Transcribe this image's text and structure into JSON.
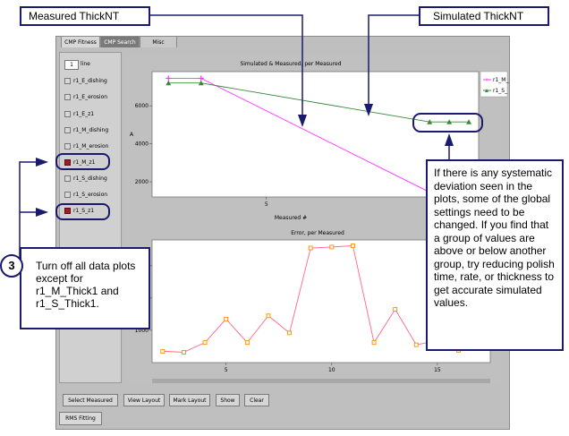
{
  "tabs": [
    "CMP Fitness",
    "CMP Search",
    "Misc"
  ],
  "spinner": {
    "value": "1",
    "label": "line"
  },
  "series_list": [
    {
      "label": "r1_E_dishing",
      "checked": false
    },
    {
      "label": "r1_E_erosion",
      "checked": false
    },
    {
      "label": "r1_E_z1",
      "checked": false
    },
    {
      "label": "r1_M_dishing",
      "checked": false
    },
    {
      "label": "r1_M_erosion",
      "checked": false
    },
    {
      "label": "r1_M_z1",
      "checked": true
    },
    {
      "label": "r1_S_dishing",
      "checked": false
    },
    {
      "label": "r1_S_erosion",
      "checked": false
    },
    {
      "label": "r1_S_z1",
      "checked": true
    }
  ],
  "colors": {
    "magenta": "#ff33ff",
    "green": "#3a8a3a",
    "orange": "#ff8c00",
    "navy": "#1a1a6e",
    "checked_box": "#a31d28"
  },
  "buttons": {
    "select_measured": "Select Measured",
    "view_layout": "View Layout",
    "mark_layout": "Mark Layout",
    "show": "Show",
    "clear": "Clear"
  },
  "bottom_tab": "RMS Fitting",
  "callouts": {
    "measured": "Measured ThickNT",
    "simulated": "Simulated ThickNT",
    "step_number": "3",
    "step_text": "Turn off all data plots except for r1_M_Thick1 and r1_S_Thick1.",
    "note": "If there is any systematic deviation seen in the plots, some of the global settings need to be changed. If you find that a group of values are above or below another group, try reducing polish time, rate, or thickness to get accurate simulated values."
  },
  "chart_data": [
    {
      "type": "line",
      "title": "Simulated & Measured, per Measured",
      "xlabel": "Measured #",
      "ylabel": "A",
      "xlim": [
        1.5,
        11.5
      ],
      "ylim": [
        1200,
        7800
      ],
      "xticks": [
        5,
        10
      ],
      "yticks": [
        2000,
        4000,
        6000
      ],
      "series": [
        {
          "name": "r1_M_",
          "color": "#ff33ff",
          "marker": "plus",
          "x": [
            2,
            3,
            10
          ],
          "y": [
            7450,
            7450,
            1450
          ]
        },
        {
          "name": "r1_S_",
          "color": "#3a8a3a",
          "marker": "triangle",
          "x": [
            2,
            3,
            10,
            10.6,
            11.2
          ],
          "y": [
            7200,
            7200,
            5150,
            5150,
            5150
          ]
        }
      ]
    },
    {
      "type": "line",
      "title": "Error, per Measured",
      "xlabel": "",
      "ylabel": "",
      "xlim": [
        1.5,
        17.5
      ],
      "ylim": [
        0,
        3800
      ],
      "xticks": [
        5,
        10,
        15
      ],
      "yticks": [
        1000,
        2000,
        3000
      ],
      "series": [
        {
          "color": "#ff6688",
          "marker": "square",
          "x": [
            2,
            3,
            4,
            5,
            6,
            7,
            8,
            9,
            10,
            11,
            12,
            13,
            14,
            15,
            16,
            17
          ],
          "y": [
            350,
            320,
            620,
            1350,
            620,
            1450,
            920,
            3550,
            3580,
            3620,
            620,
            1650,
            550,
            680,
            380,
            600
          ]
        }
      ]
    }
  ]
}
